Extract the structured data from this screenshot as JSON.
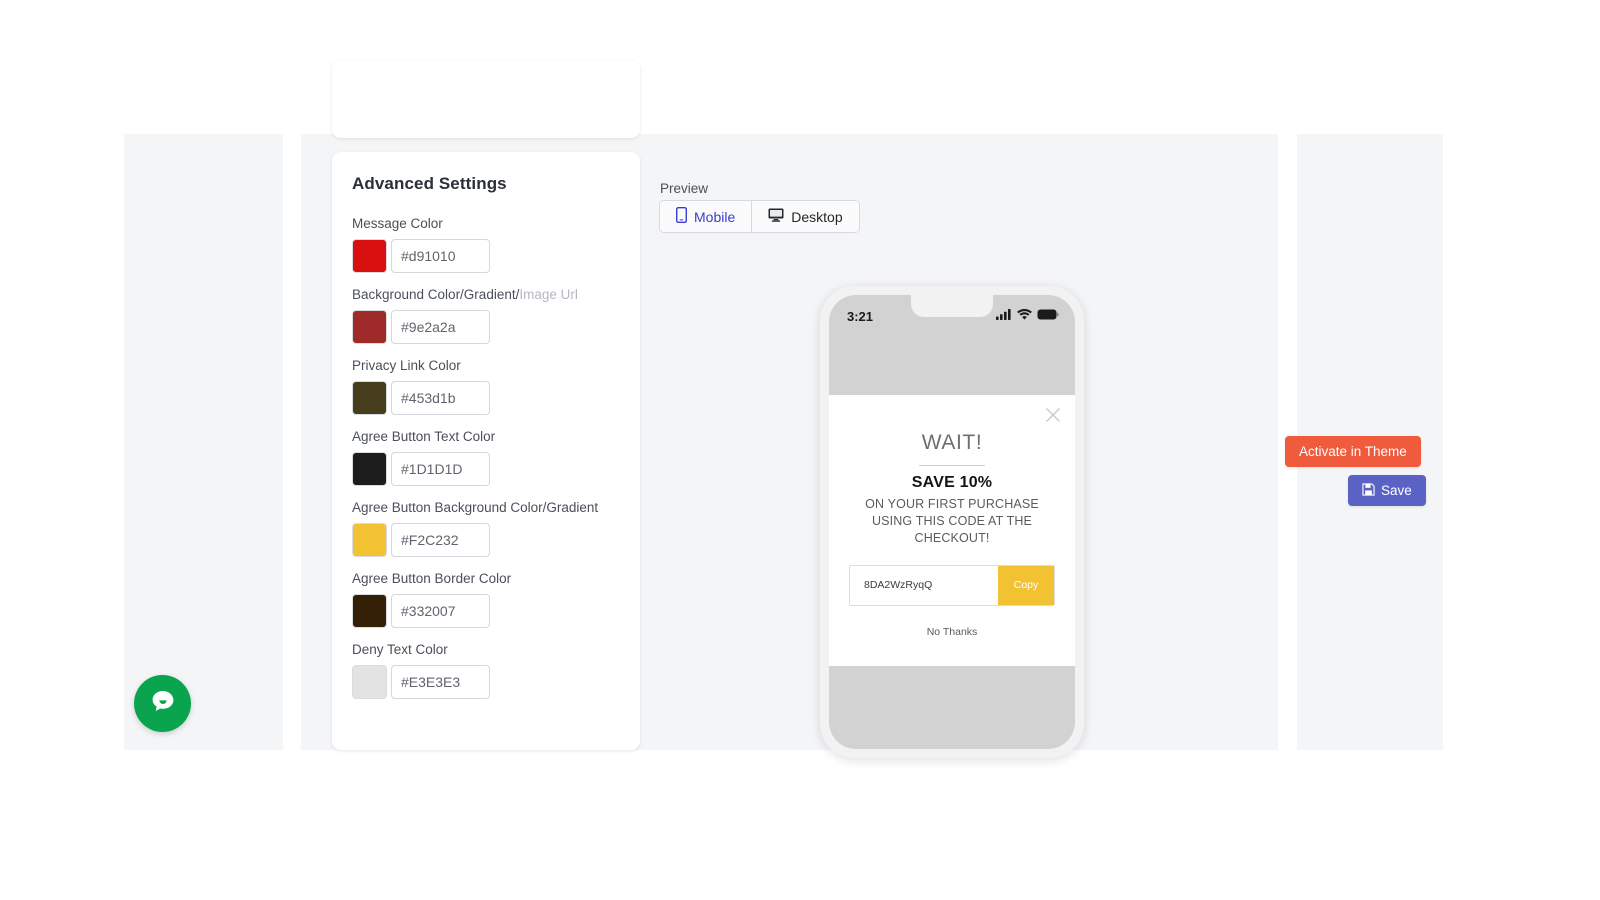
{
  "settings_card": {
    "title": "Advanced Settings",
    "fields": [
      {
        "label": "Message Color",
        "label_muted": "",
        "value": "#d91010",
        "swatch": "#d91010"
      },
      {
        "label": "Background Color/Gradient/",
        "label_muted": "Image Url",
        "value": "#9e2a2a",
        "swatch": "#9e2a2a"
      },
      {
        "label": "Privacy Link Color",
        "label_muted": "",
        "value": "#453d1b",
        "swatch": "#453d1b"
      },
      {
        "label": "Agree Button Text Color",
        "label_muted": "",
        "value": "#1D1D1D",
        "swatch": "#1D1D1D"
      },
      {
        "label": "Agree Button Background Color/Gradient",
        "label_muted": "",
        "value": "#F2C232",
        "swatch": "#F2C232"
      },
      {
        "label": "Agree Button Border Color",
        "label_muted": "",
        "value": "#332007",
        "swatch": "#332007"
      },
      {
        "label": "Deny Text Color",
        "label_muted": "",
        "value": "#E3E3E3",
        "swatch": "#E3E3E3"
      }
    ]
  },
  "preview": {
    "label": "Preview",
    "tabs": [
      {
        "label": "Mobile",
        "icon": "mobile-phone-icon",
        "active": true
      },
      {
        "label": "Desktop",
        "icon": "desktop-monitor-icon",
        "active": false
      }
    ]
  },
  "phone": {
    "status_time": "3:21",
    "status_icons": [
      "cellular-signal-icon",
      "wifi-icon",
      "battery-icon"
    ],
    "modal": {
      "close_icon": "close-x-icon",
      "heading": "WAIT!",
      "save_line": "SAVE 10%",
      "subtext": "ON YOUR FIRST PURCHASE USING THIS CODE AT THE CHECKOUT!",
      "code_value": "8DA2WzRyqQ",
      "copy_label": "Copy",
      "copy_bg": "#f2c232",
      "deny_label": "No Thanks"
    }
  },
  "actions": {
    "activate_label": "Activate in Theme",
    "activate_color": "#ef5b3c",
    "save_label": "Save",
    "save_color": "#5a63c4",
    "save_icon": "floppy-disk-save-icon"
  },
  "chat": {
    "icon": "chat-bubble-icon",
    "color": "#0ba44e"
  }
}
